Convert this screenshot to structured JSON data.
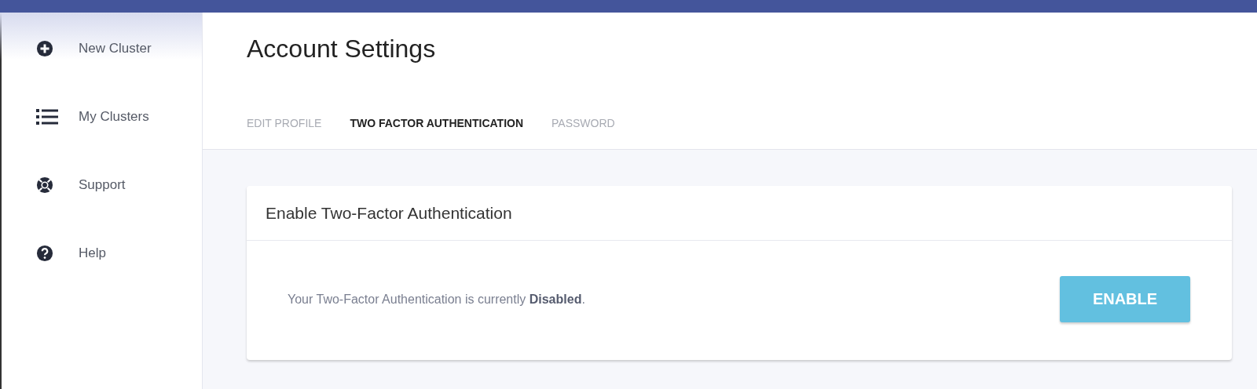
{
  "sidebar": {
    "items": [
      {
        "label": "New Cluster"
      },
      {
        "label": "My Clusters"
      },
      {
        "label": "Support"
      },
      {
        "label": "Help"
      }
    ]
  },
  "page_title": "Account Settings",
  "tabs": [
    {
      "label": "EDIT PROFILE",
      "selected": false
    },
    {
      "label": "TWO FACTOR AUTHENTICATION",
      "selected": true
    },
    {
      "label": "PASSWORD",
      "selected": false
    }
  ],
  "card": {
    "title": "Enable Two-Factor Authentication",
    "message": "Your Two-Factor Authentication is currently **Disabled**.",
    "button": "ENABLE"
  }
}
